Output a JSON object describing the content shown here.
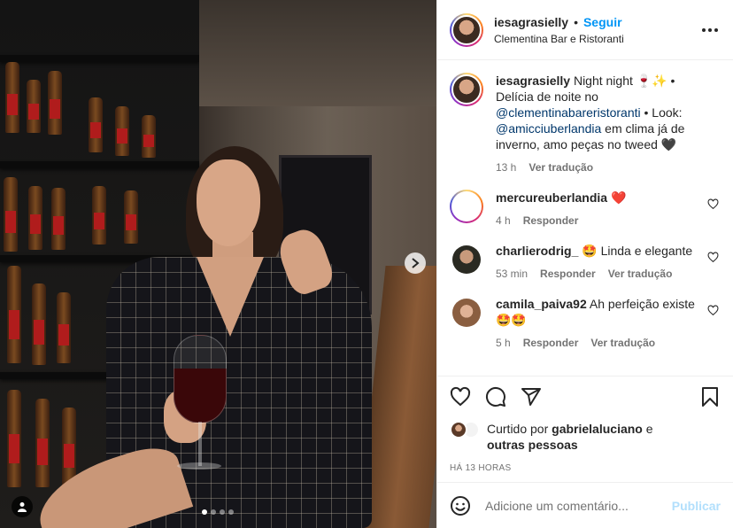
{
  "post": {
    "author": "iesagrasielly",
    "separator": "•",
    "follow_label": "Seguir",
    "location": "Clementina Bar e Ristoranti",
    "carousel": {
      "current": 1,
      "total": 4
    }
  },
  "caption": {
    "username": "iesagrasielly",
    "text_1": " Night night 🍷✨ • Delícia de noite no ",
    "mention_1": "@clementinabareristoranti",
    "text_2": " • Look: ",
    "mention_2": "@amicciuberlandia",
    "text_3": " em clima já de inverno, amo peças no tweed 🖤",
    "time": "13 h",
    "translate": "Ver tradução"
  },
  "comments": [
    {
      "username": "mercureuberlandia",
      "text": " ❤️",
      "time": "4 h",
      "reply": "Responder",
      "translate": ""
    },
    {
      "username": "charlierodrig_",
      "text": " 🤩 Linda e elegante",
      "time": "53 min",
      "reply": "Responder",
      "translate": "Ver tradução"
    },
    {
      "username": "camila_paiva92",
      "text": " Ah perfeição existe 🤩🤩",
      "time": "5 h",
      "reply": "Responder",
      "translate": "Ver tradução"
    }
  ],
  "likes": {
    "prefix": "Curtido por ",
    "user": "gabrielaluciano",
    "suffix": " e ",
    "others": "outras pessoas"
  },
  "posted_ago": "HÁ 13 HORAS",
  "comment_box": {
    "placeholder": "Adicione um comentário...",
    "publish_label": "Publicar"
  },
  "colors": {
    "accent": "#0095f6",
    "publish_disabled": "#b2dffc",
    "muted": "#737373",
    "mention": "#00376b"
  },
  "icons": [
    "next-arrow-icon",
    "person-tag-icon",
    "more-options-icon",
    "heart-icon",
    "comment-icon",
    "share-icon",
    "bookmark-icon",
    "emoji-icon"
  ]
}
